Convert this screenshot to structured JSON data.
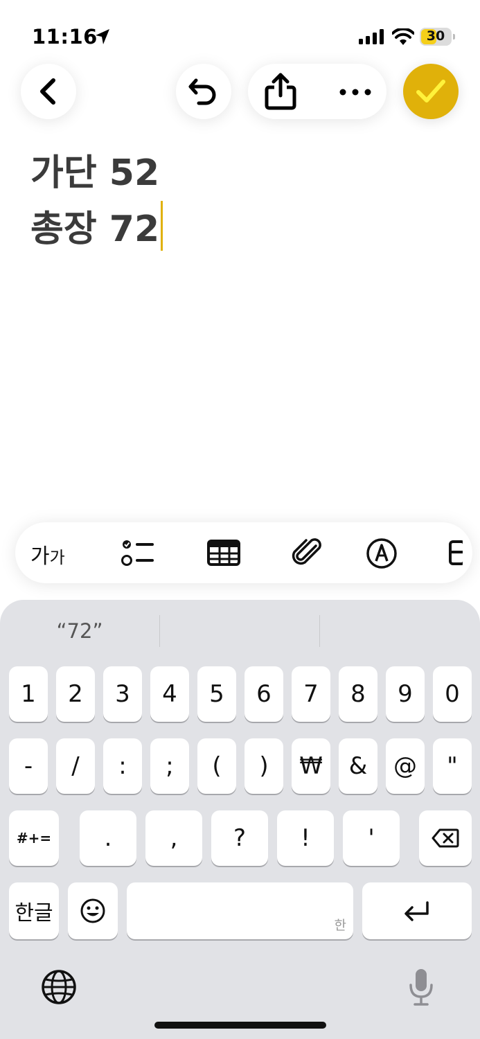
{
  "status_bar": {
    "time": "11:16",
    "battery": "30",
    "battery_color": "#f5cf1a"
  },
  "toolbar": {
    "back_icon": "chevron-left-icon",
    "undo_icon": "undo-icon",
    "share_icon": "share-icon",
    "more_icon": "ellipsis-icon",
    "done_icon": "checkmark-icon",
    "accent": "#e0b10a"
  },
  "note": {
    "lines": [
      "가단 52",
      "총장 72"
    ]
  },
  "format_bar": {
    "text_style_label": "가",
    "text_style_label_small": "가",
    "icons": [
      "checklist-icon",
      "table-icon",
      "paperclip-icon",
      "markup-icon",
      "more-tools-icon"
    ]
  },
  "keyboard": {
    "suggestions": [
      "“72”",
      "",
      ""
    ],
    "row1": [
      "1",
      "2",
      "3",
      "4",
      "5",
      "6",
      "7",
      "8",
      "9",
      "0"
    ],
    "row2": [
      "-",
      "/",
      ":",
      ";",
      "(",
      ")",
      "₩",
      "&",
      "@",
      "\""
    ],
    "row3": [
      "#+=",
      ".",
      ",",
      "?",
      "!",
      "'"
    ],
    "row4": {
      "lang": "한글",
      "space_hint": "한"
    }
  }
}
